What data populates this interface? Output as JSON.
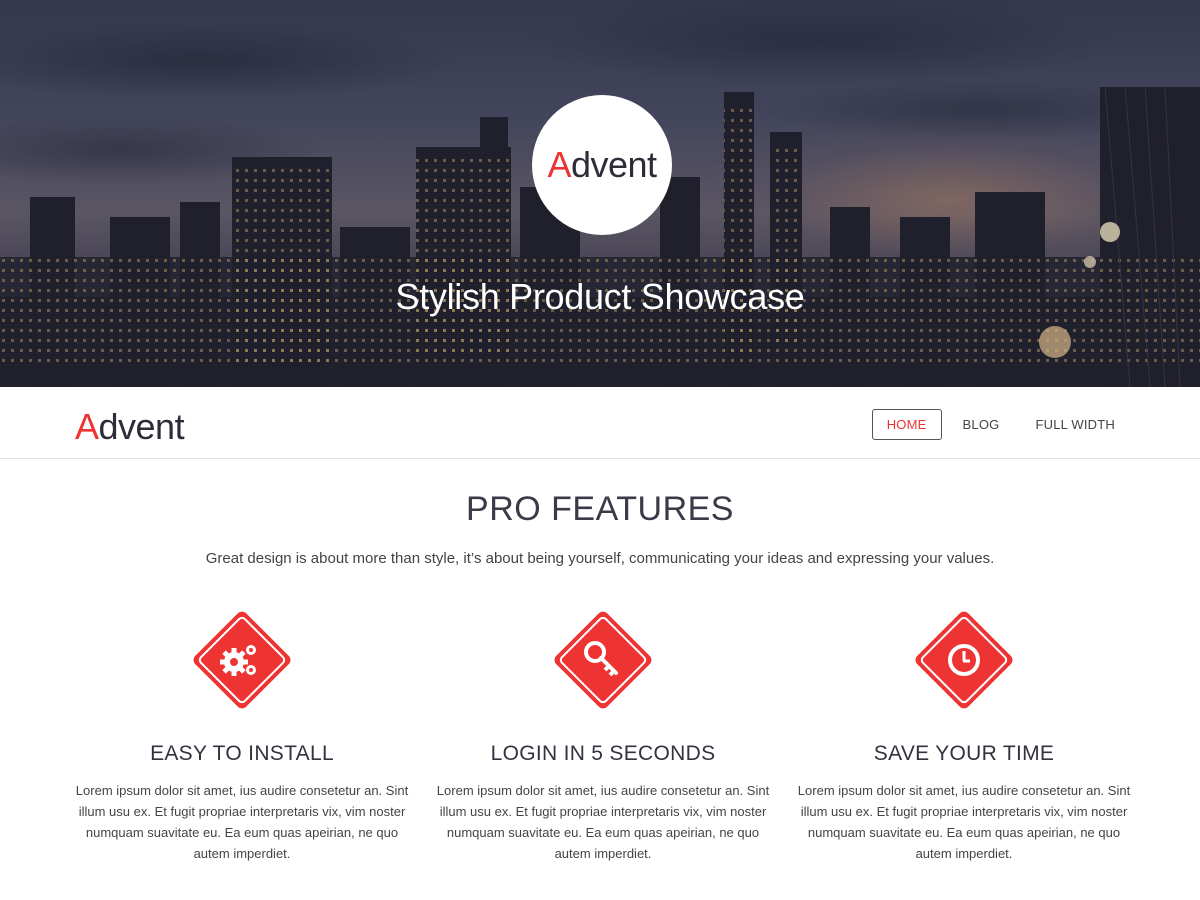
{
  "hero": {
    "logo_first_letter": "A",
    "logo_rest": "dvent",
    "title": "Stylish Product Showcase",
    "background": "city-skyline-dusk-photo"
  },
  "navbar": {
    "brand_first_letter": "A",
    "brand_rest": "dvent",
    "items": [
      {
        "label": "HOME",
        "active": true
      },
      {
        "label": "BLOG",
        "active": false
      },
      {
        "label": "FULL WIDTH",
        "active": false
      }
    ]
  },
  "features": {
    "title": "PRO FEATURES",
    "subtitle": "Great design is about more than style, it’s about being yourself, communicating your ideas and expressing your values.",
    "items": [
      {
        "icon": "gears-icon",
        "title": "EASY TO INSTALL",
        "text": "Lorem ipsum dolor sit amet, ius audire consetetur an. Sint illum usu ex. Et fugit propriae interpretaris vix, vim noster numquam suavitate eu. Ea eum quas apeirian, ne quo autem imperdiet."
      },
      {
        "icon": "key-icon",
        "title": "LOGIN IN 5 SECONDS",
        "text": "Lorem ipsum dolor sit amet, ius audire consetetur an. Sint illum usu ex. Et fugit propriae interpretaris vix, vim noster numquam suavitate eu. Ea eum quas apeirian, ne quo autem imperdiet."
      },
      {
        "icon": "clock-icon",
        "title": "SAVE YOUR TIME",
        "text": "Lorem ipsum dolor sit amet, ius audire consetetur an. Sint illum usu ex. Et fugit propriae interpretaris vix, vim noster numquam suavitate eu. Ea eum quas apeirian, ne quo autem imperdiet."
      }
    ]
  },
  "colors": {
    "accent": "#ee3333",
    "text_dark": "#333340",
    "nav_border": "#555555"
  }
}
